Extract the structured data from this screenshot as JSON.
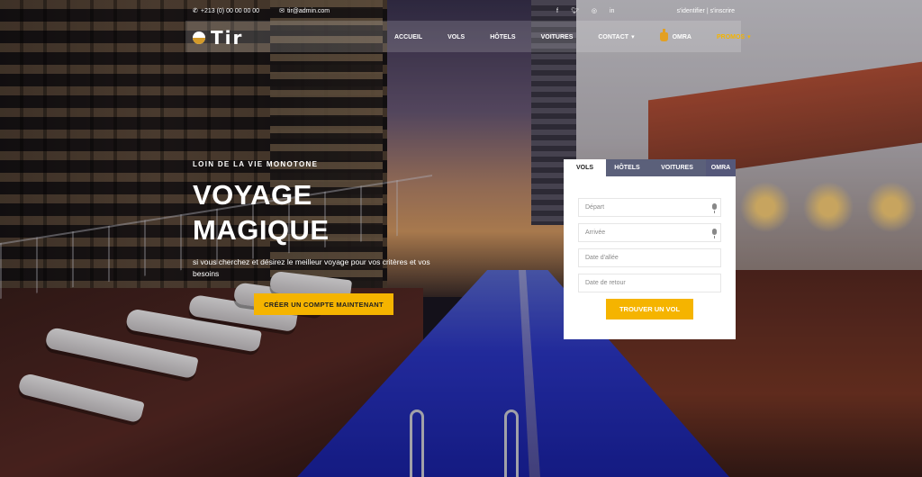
{
  "topbar": {
    "phone": "+213 (0) 00 00 00 00",
    "email": "tir@admin.com",
    "social": [
      "facebook-icon",
      "twitter-icon",
      "instagram-icon",
      "linkedin-icon"
    ],
    "auth": "s'identifier | s'inscrire"
  },
  "brand": {
    "name": "Tir",
    "colors": {
      "accent": "#f5b400",
      "promo": "#f5b400"
    }
  },
  "nav": {
    "items": [
      "ACCUEIL",
      "VOLS",
      "HÔTELS",
      "VOITURES",
      "CONTACT",
      "OMRA",
      "PROMOS"
    ]
  },
  "hero": {
    "eyebrow": "LOIN DE LA VIE MONOTONE",
    "title_line1": "VOYAGE",
    "title_line2": "MAGIQUE",
    "lead": "si vous cherchez et désirez le meilleur voyage pour vos critères et vos besoins",
    "cta": "CRÉER UN COMPTE MAINTENANT"
  },
  "search": {
    "tabs": [
      "VOLS",
      "HÔTELS",
      "VOITURES",
      "OMRA"
    ],
    "fields": {
      "depart": "Départ",
      "arrivee": "Arrivée",
      "date_aller": "Date d'allée",
      "date_retour": "Date de retour"
    },
    "button": "TROUVER UN VOL"
  }
}
